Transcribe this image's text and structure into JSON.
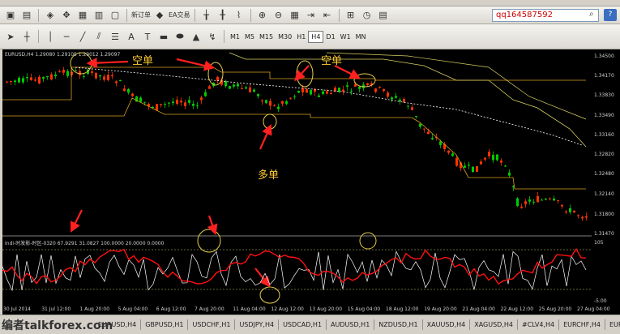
{
  "toolbar1": {
    "new_order_label": "新订单",
    "ea_label": "EA交易",
    "search_value": "qq164587592"
  },
  "timeframes": [
    "M1",
    "M5",
    "M15",
    "M30",
    "H1",
    "H4",
    "D1",
    "W1",
    "MN"
  ],
  "active_timeframe": "H4",
  "chart": {
    "symbol_label": "EURUSD,H4  1.29080 1.29105 1.29012 1.29097",
    "indicator_label": "Indi-时发影-时区-0320 67.9291 31.0827 100.0000 20.0000 0.0000",
    "annotations": {
      "short1": "空单",
      "short2": "空单",
      "long1": "多单"
    },
    "price_ticks": [
      "1.34500",
      "1.34170",
      "1.33830",
      "1.33490",
      "1.33160",
      "1.32820",
      "1.32480",
      "1.32140",
      "1.31800",
      "1.31470"
    ],
    "indicator_ticks": [
      "105",
      "-5.00"
    ],
    "time_ticks": [
      "30 Jul 2014",
      "31 Jul 12:00",
      "1 Aug 20:00",
      "5 Aug 04:00",
      "6 Aug 12:00",
      "7 Aug 20:00",
      "11 Aug 04:00",
      "12 Aug 12:00",
      "13 Aug 20:00",
      "15 Aug 04:00",
      "18 Aug 12:00",
      "19 Aug 20:00",
      "21 Aug 04:00",
      "22 Aug 12:00",
      "25 Aug 20:00",
      "27 Aug 04:00"
    ],
    "colors": {
      "bull": "#00cc00",
      "bear": "#ff3300",
      "highlight": "#e6cc4a",
      "arrow": "#ff2020",
      "ma_dotted": "#ffffff",
      "indicator_white": "#ffffff",
      "indicator_red": "#ff1010"
    }
  },
  "tabs": [
    "EURUSD,H4",
    "GBPUSD,H1",
    "USDCHF,H1",
    "USDJPY,H4",
    "USDCAD,H1",
    "AUDUSD,H1",
    "NZDUSD,H1",
    "XAUUSD,H4",
    "XAGUSD,H4",
    "#CLV4,H4",
    "EURCHF,H4",
    "EURGB"
  ],
  "watermark": {
    "text": "编者",
    "domain": "talkforex.com"
  }
}
